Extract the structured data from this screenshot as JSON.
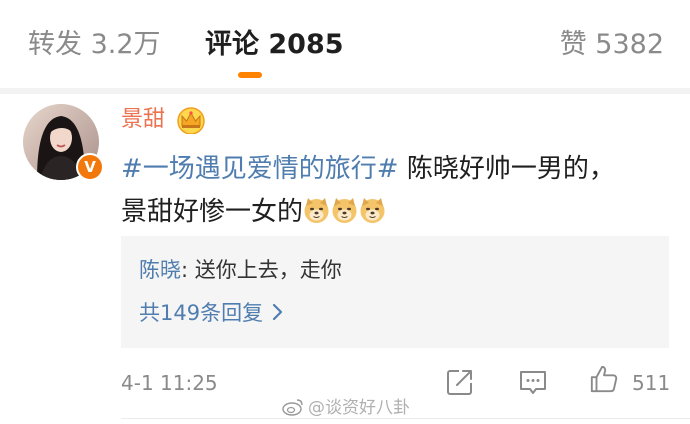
{
  "tabs": {
    "repost": "转发 3.2万",
    "comment": "评论 2085",
    "like": "赞 5382"
  },
  "comment": {
    "username": "景甜",
    "badge": "V",
    "hashtag": "#一场遇见爱情的旅行#",
    "text_line1": " 陈晓好帅一男的，",
    "text_line2": "景甜好惨一女的",
    "emoji_name": "doge-emoji",
    "timestamp": "4-1 11:25",
    "like_count": "511"
  },
  "reply": {
    "user": "陈晓",
    "text": ": 送你上去，走你",
    "more": "共149条回复"
  },
  "watermark": "@谈资好八卦",
  "colors": {
    "accent": "#ff8200",
    "username": "#eb7350",
    "link": "#507daf",
    "badge": "#f2780c"
  }
}
